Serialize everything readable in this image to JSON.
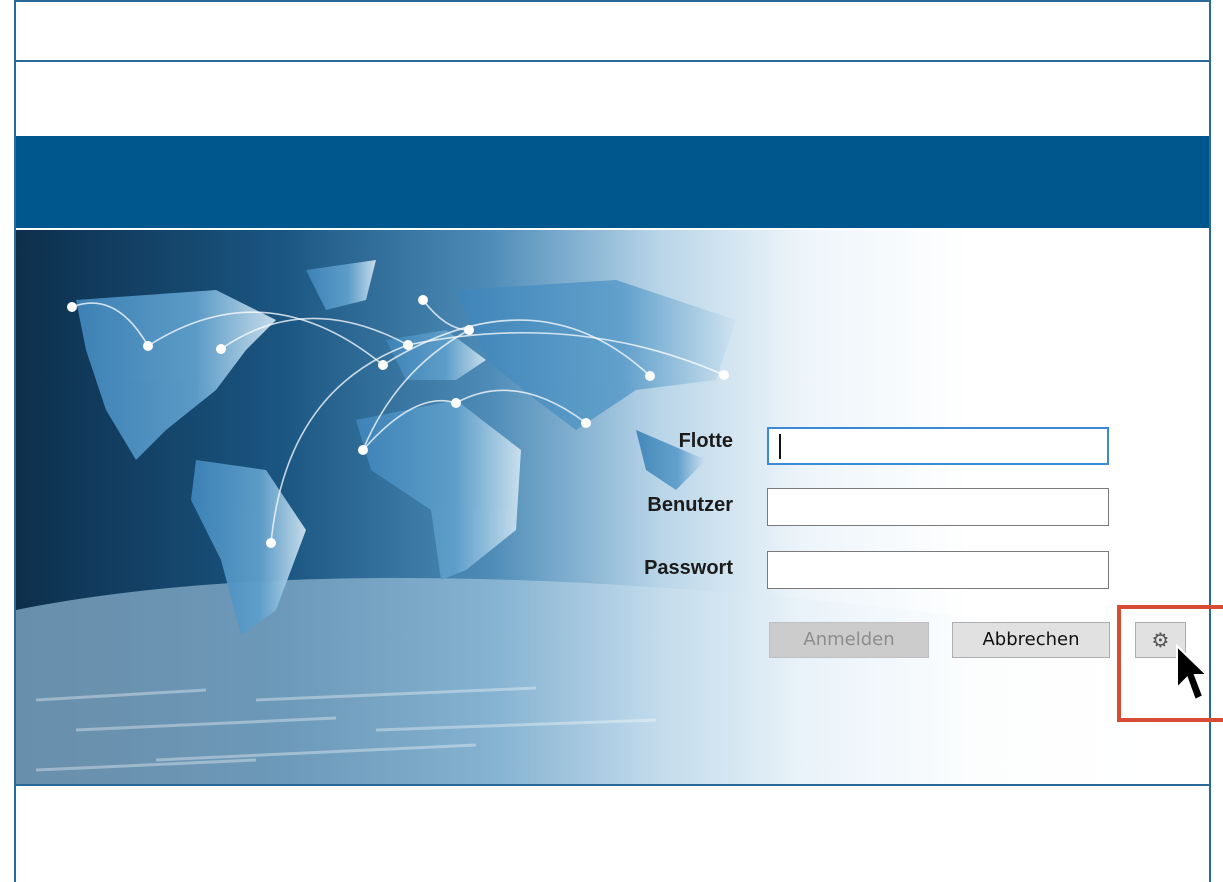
{
  "login": {
    "fleet_label": "Flotte",
    "user_label": "Benutzer",
    "password_label": "Passwort",
    "fleet_value": "",
    "user_value": "",
    "password_value": "",
    "login_button": "Anmelden",
    "cancel_button": "Abbrechen",
    "settings_icon": "gear-icon"
  },
  "colors": {
    "header_band": "#00578e",
    "highlight": "#d84b35",
    "frame": "#2a6a9a"
  }
}
